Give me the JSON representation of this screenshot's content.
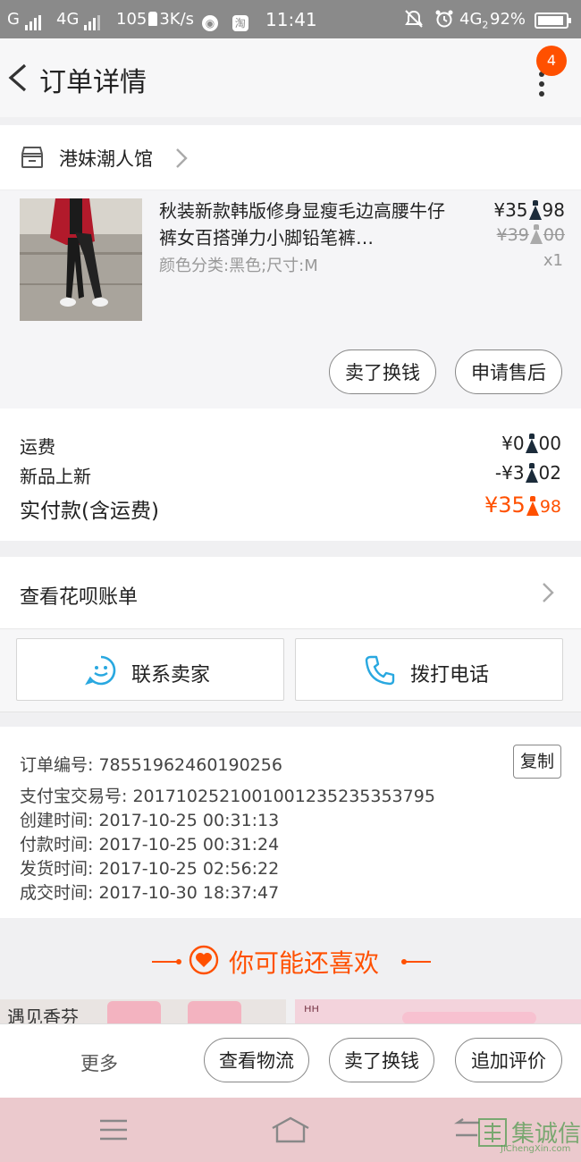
{
  "status_bar": {
    "carrier_left": "G",
    "network": "4G",
    "speed_num": "105",
    "speed_unit": "3K/s",
    "time": "11:41",
    "network_right": "4G",
    "network_right_sub": "2",
    "battery": "92%",
    "battery_level": 0.92,
    "taobao_icon_text": "淘"
  },
  "header": {
    "title": "订单详情",
    "badge_count": "4"
  },
  "shop": {
    "name": "港妹潮人馆"
  },
  "product": {
    "title": "秋装新款韩版修身显瘦毛边高腰牛仔裤女百搭弹力小脚铅笔裤…",
    "spec": "颜色分类:黑色;尺寸:M",
    "price_main": "¥35",
    "price_cents": "98",
    "orig_price_main": "¥39",
    "orig_price_cents": "00",
    "quantity": "x1"
  },
  "product_actions": {
    "sell_label": "卖了换钱",
    "after_sale_label": "申请售后"
  },
  "summary": {
    "shipping_label": "运费",
    "shipping_main": "¥0",
    "shipping_cents": "00",
    "discount_label": "新品上新",
    "discount_main": "-¥3",
    "discount_cents": "02",
    "total_label": "实付款(含运费)",
    "total_main": "¥35",
    "total_cents": "98"
  },
  "huabei": {
    "label": "查看花呗账单"
  },
  "contact": {
    "seller_label": "联系卖家",
    "call_label": "拨打电话"
  },
  "order_info": {
    "copy_label": "复制",
    "lines": [
      "订单编号: 78551962460190256",
      "支付宝交易号: 2017102521001001235235353795",
      "创建时间: 2017-10-25 00:31:13",
      "付款时间: 2017-10-25 00:31:24",
      "发货时间: 2017-10-25 02:56:22",
      "成交时间: 2017-10-30 18:37:47"
    ]
  },
  "recommend": {
    "title": "你可能还喜欢",
    "thumb_left_text": "遇见香芬",
    "thumb_right_text": "ᴴᴴ"
  },
  "action_bar": {
    "more_label": "更多",
    "logistics_label": "查看物流",
    "sell_label": "卖了换钱",
    "review_label": "追加评价"
  },
  "watermark": {
    "text": "集诚信",
    "url": "JiChengXin.com"
  },
  "colors": {
    "accent": "#ff5000",
    "contact_icon": "#29a8e0",
    "navbar": "#ebc9cd"
  }
}
